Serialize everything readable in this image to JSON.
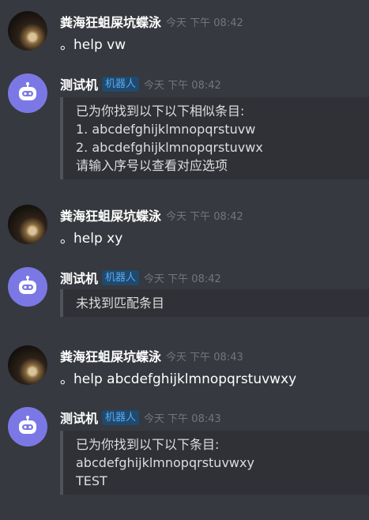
{
  "messages": [
    {
      "author": "粪海狂蛆屎坑蝶泳",
      "time": "今天 下午 08:42",
      "text": "。help vw"
    },
    {
      "author": "测试机",
      "badge": "机器人",
      "time": "今天 下午 08:42",
      "lines": [
        "已为你找到以下以下相似条目:",
        "1. abcdefghijklmnopqrstuvw",
        "2. abcdefghijklmnopqrstuvwx",
        "请输入序号以查看对应选项"
      ]
    },
    {
      "author": "粪海狂蛆屎坑蝶泳",
      "time": "今天 下午 08:42",
      "text": "。help xy"
    },
    {
      "author": "测试机",
      "badge": "机器人",
      "time": "今天 下午 08:42",
      "lines": [
        "未找到匹配条目"
      ]
    },
    {
      "author": "粪海狂蛆屎坑蝶泳",
      "time": "今天 下午 08:43",
      "text": "。help abcdefghijklmnopqrstuvwxy"
    },
    {
      "author": "测试机",
      "badge": "机器人",
      "time": "今天 下午 08:43",
      "lines": [
        "已为你找到以下以下条目:",
        "abcdefghijklmnopqrstuvwxy",
        "TEST"
      ]
    }
  ],
  "colors": {
    "background": "#36393f",
    "embed_background": "#2f3136",
    "bot_avatar": "#7b78e6",
    "bot_badge_text": "#5aa9f2",
    "timestamp": "#72767d"
  },
  "icons": {
    "user_avatar": "user-avatar-photo",
    "bot_avatar": "robot-icon"
  }
}
